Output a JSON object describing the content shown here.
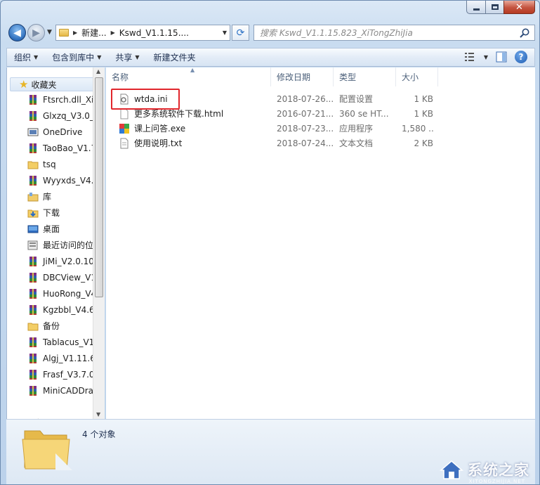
{
  "window": {
    "address": {
      "crumbs": [
        "新建...",
        "Kswd_V1.1.15...."
      ]
    },
    "search": {
      "placeholder": "搜索 Kswd_V1.1.15.823_XiTongZhiJia"
    }
  },
  "toolbar": {
    "organize": "组织",
    "include_in_library": "包含到库中",
    "share": "共享",
    "new_folder": "新建文件夹"
  },
  "nav": {
    "favorites_label": "收藏夹",
    "items": [
      {
        "label": "Ftsrch.dll_XiT",
        "icon": "winrar-icon"
      },
      {
        "label": "Glxzq_V3.0_X",
        "icon": "winrar-icon"
      },
      {
        "label": "OneDrive",
        "icon": "onedrive-icon"
      },
      {
        "label": "TaoBao_V1.7",
        "icon": "winrar-icon"
      },
      {
        "label": "tsq",
        "icon": "folder-icon"
      },
      {
        "label": "Wyyxds_V4.1",
        "icon": "winrar-icon"
      },
      {
        "label": "库",
        "icon": "library-icon"
      },
      {
        "label": "下载",
        "icon": "downloads-icon"
      },
      {
        "label": "桌面",
        "icon": "desktop-icon"
      },
      {
        "label": "最近访问的位",
        "icon": "recent-places-icon"
      },
      {
        "label": "JiMi_V2.0.10.",
        "icon": "winrar-icon"
      },
      {
        "label": "DBCView_V1",
        "icon": "winrar-icon"
      },
      {
        "label": "HuoRong_V4",
        "icon": "winrar-icon"
      },
      {
        "label": "Kgzbbl_V4.6",
        "icon": "winrar-icon"
      },
      {
        "label": "备份",
        "icon": "folder-icon"
      },
      {
        "label": "Tablacus_V1.",
        "icon": "winrar-icon"
      },
      {
        "label": "Algj_V1.11.6.",
        "icon": "winrar-icon"
      },
      {
        "label": "Frasf_V3.7.0.",
        "icon": "winrar-icon"
      },
      {
        "label": "MiniCADDrav",
        "icon": "winrar-icon"
      }
    ],
    "library_tail": "库"
  },
  "columns": {
    "name": "名称",
    "date": "修改日期",
    "type": "类型",
    "size": "大小"
  },
  "files": [
    {
      "name": "wtda.ini",
      "date": "2018-07-26...",
      "type": "配置设置",
      "size": "1 KB",
      "icon": "ini-settings-icon"
    },
    {
      "name": "更多系统软件下载.html",
      "date": "2016-07-21...",
      "type": "360 se HT...",
      "size": "1 KB",
      "icon": "html-file-icon"
    },
    {
      "name": "课上问答.exe",
      "date": "2018-07-23...",
      "type": "应用程序",
      "size": "1,580 ...",
      "icon": "exe-app-icon"
    },
    {
      "name": "使用说明.txt",
      "date": "2018-07-24...",
      "type": "文本文档",
      "size": "2 KB",
      "icon": "text-file-icon"
    }
  ],
  "details": {
    "count": "4 个对象"
  },
  "watermark": {
    "text": "系统之家",
    "sub": "XITONGZHIJIA.NET"
  },
  "colors": {
    "highlight_border": "#e1262c",
    "accent": "#2e6fbd"
  }
}
